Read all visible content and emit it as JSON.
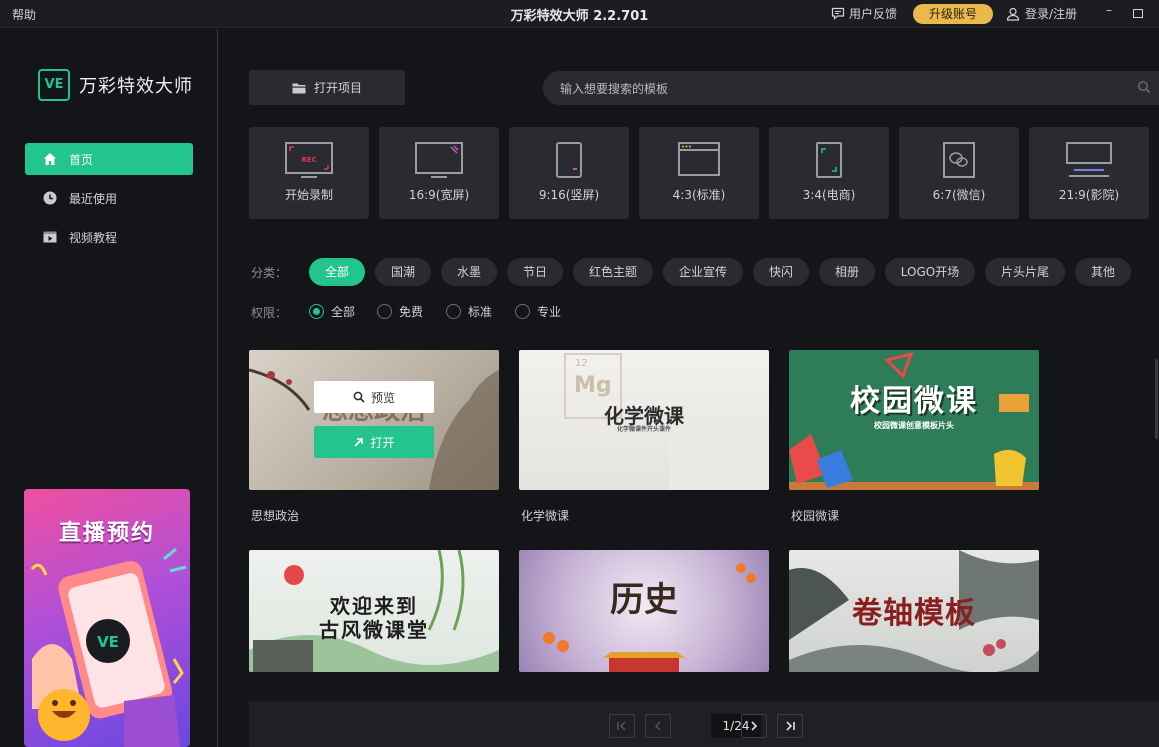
{
  "titlebar": {
    "help": "帮助",
    "title": "万彩特效大师 2.2.701",
    "feedback": "用户反馈",
    "upgrade": "升级账号",
    "login": "登录/注册",
    "minimize": "–"
  },
  "sidebar": {
    "logo_mark": "VE",
    "logo_text": "万彩特效大师",
    "items": [
      {
        "label": "首页",
        "icon": "home-icon"
      },
      {
        "label": "最近使用",
        "icon": "clock-icon"
      },
      {
        "label": "视频教程",
        "icon": "video-icon"
      }
    ],
    "promo": {
      "title": "直播预约",
      "mark": "VE"
    }
  },
  "toolbar": {
    "open_project": "打开项目",
    "search_placeholder": "输入想要搜索的模板"
  },
  "ratios": [
    {
      "label": "开始录制",
      "badge": "REC"
    },
    {
      "label": "16:9(宽屏)"
    },
    {
      "label": "9:16(竖屏)"
    },
    {
      "label": "4:3(标准)"
    },
    {
      "label": "3:4(电商)"
    },
    {
      "label": "6:7(微信)"
    },
    {
      "label": "21:9(影院)"
    }
  ],
  "filters": {
    "category_label": "分类：",
    "categories": [
      "全部",
      "国潮",
      "水墨",
      "节日",
      "红色主题",
      "企业宣传",
      "快闪",
      "相册",
      "LOGO开场",
      "片头片尾",
      "其他"
    ],
    "active_category": "全部",
    "permission_label": "权限：",
    "permissions": [
      "全部",
      "免费",
      "标准",
      "专业"
    ],
    "active_permission": "全部"
  },
  "templates": [
    {
      "title": "思想政治",
      "thumb_text": "思想政治",
      "hover": {
        "preview": "预览",
        "open": "打开"
      }
    },
    {
      "title": "化学微课",
      "thumb_text": "化学微课",
      "thumb_sub": "化学微课件开头课件",
      "thumb_element": "Mg",
      "thumb_number": "12"
    },
    {
      "title": "校园微课",
      "thumb_text": "校园微课",
      "thumb_sub": "校园微课创意模板片头"
    },
    {
      "title": "",
      "thumb_text": "欢迎来到",
      "thumb_text2": "古风微课堂"
    },
    {
      "title": "",
      "thumb_text": "历史"
    },
    {
      "title": "",
      "thumb_text": "卷轴模板"
    }
  ],
  "pagination": {
    "page": "1/24"
  },
  "colors": {
    "accent": "#23c48e",
    "upgrade": "#e9b94e",
    "background": "#141518",
    "panel": "#2a2b30"
  }
}
